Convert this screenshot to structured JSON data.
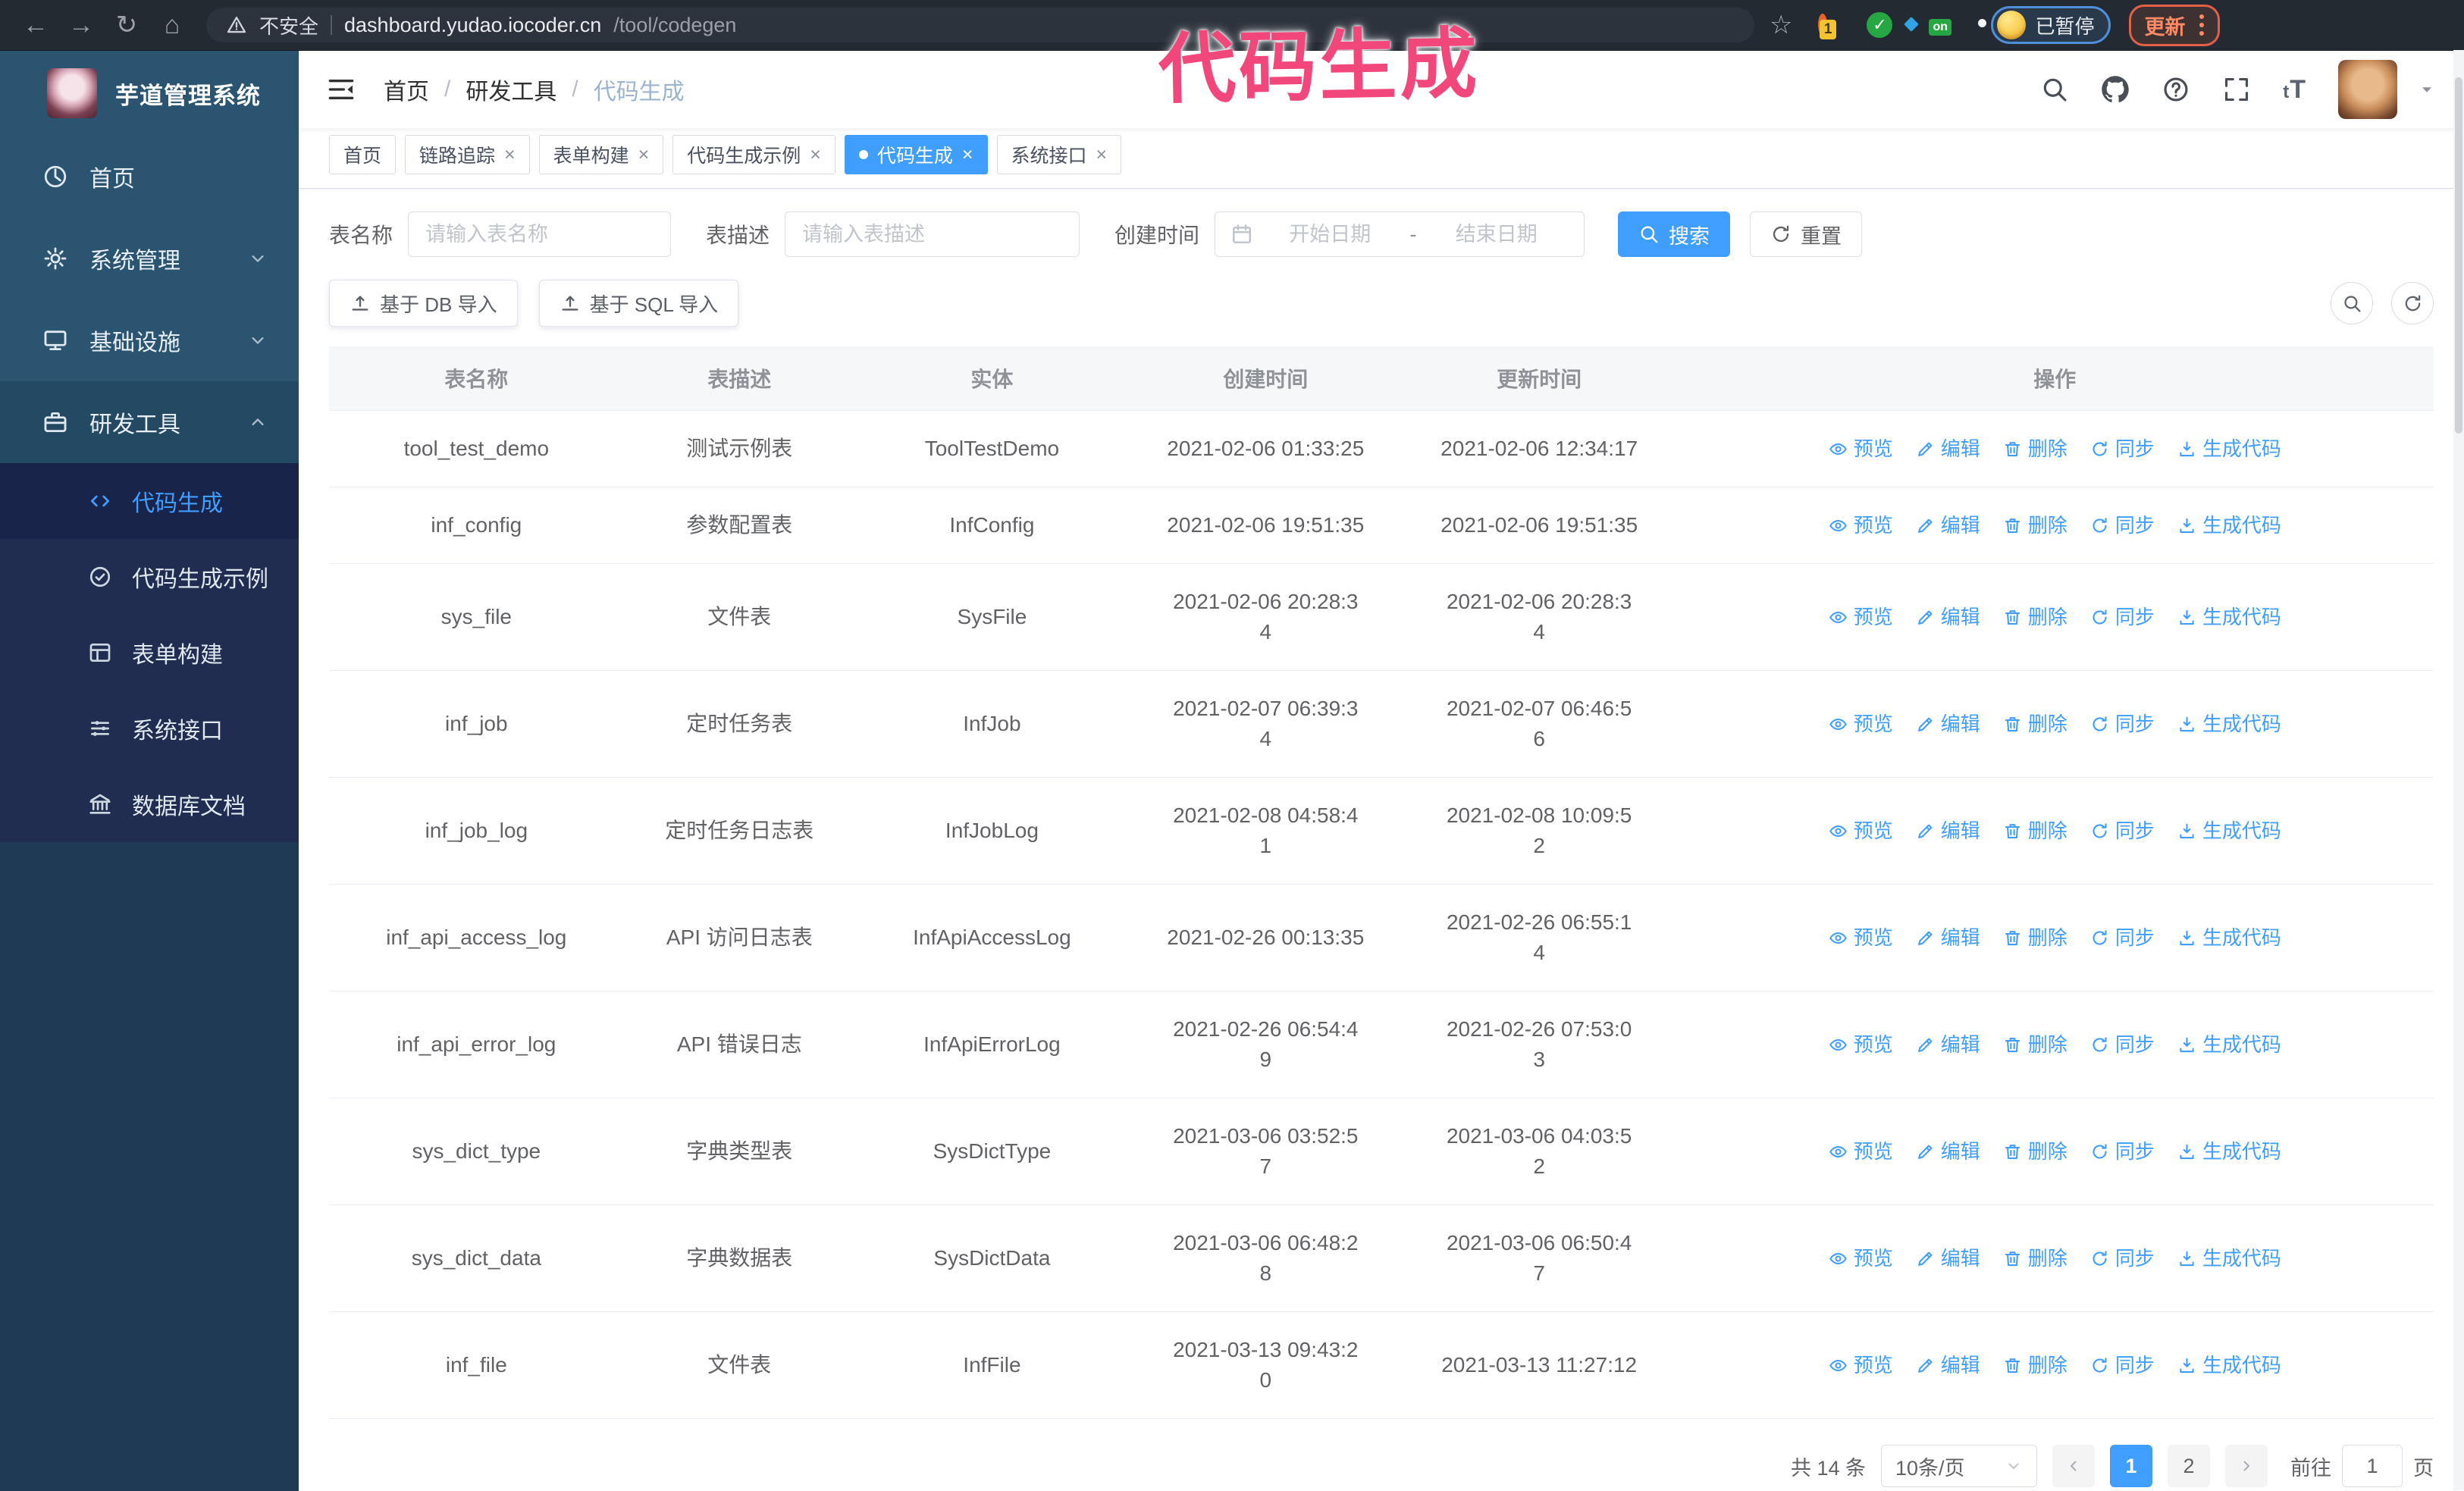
{
  "colors": {
    "accent": "#409eff",
    "annotation_pink": "#f2477b",
    "sidebar_bg": "#2a5470",
    "submenu_bg": "#202c50"
  },
  "browser": {
    "security_label": "不安全",
    "url_host": "dashboard.yudao.iocoder.cn",
    "url_path": "/tool/codegen",
    "extension_badge": "1",
    "extension_on_badge": "on",
    "paused_badge": "已暂停",
    "update_button": "更新"
  },
  "annotation": {
    "text": "代码生成"
  },
  "sidebar": {
    "title": "芋道管理系统",
    "menu": [
      {
        "label": "首页",
        "icon": "dashboard-icon",
        "chevron": ""
      },
      {
        "label": "系统管理",
        "icon": "gear-icon",
        "chevron": "down"
      },
      {
        "label": "基础设施",
        "icon": "infra-icon",
        "chevron": "down"
      },
      {
        "label": "研发工具",
        "icon": "tools-icon",
        "chevron": "up",
        "open": true
      }
    ],
    "submenu": [
      {
        "label": "代码生成",
        "icon": "code-icon",
        "active": true
      },
      {
        "label": "代码生成示例",
        "icon": "example-icon",
        "active": false
      },
      {
        "label": "表单构建",
        "icon": "form-icon",
        "active": false
      },
      {
        "label": "系统接口",
        "icon": "api-icon",
        "active": false
      },
      {
        "label": "数据库文档",
        "icon": "db-icon",
        "active": false
      }
    ]
  },
  "header": {
    "breadcrumb": [
      "首页",
      "研发工具",
      "代码生成"
    ]
  },
  "tabs": [
    {
      "label": "首页",
      "closable": false,
      "active": false
    },
    {
      "label": "链路追踪",
      "closable": true,
      "active": false
    },
    {
      "label": "表单构建",
      "closable": true,
      "active": false
    },
    {
      "label": "代码生成示例",
      "closable": true,
      "active": false
    },
    {
      "label": "代码生成",
      "closable": true,
      "active": true
    },
    {
      "label": "系统接口",
      "closable": true,
      "active": false
    }
  ],
  "search": {
    "name_label": "表名称",
    "name_placeholder": "请输入表名称",
    "desc_label": "表描述",
    "desc_placeholder": "请输入表描述",
    "time_label": "创建时间",
    "start_placeholder": "开始日期",
    "range_separator": "-",
    "end_placeholder": "结束日期",
    "search_button": "搜索",
    "reset_button": "重置"
  },
  "toolbar": {
    "import_db": "基于 DB 导入",
    "import_sql": "基于 SQL 导入"
  },
  "table": {
    "columns": [
      "表名称",
      "表描述",
      "实体",
      "创建时间",
      "更新时间",
      "操作"
    ],
    "actions": [
      {
        "label": "预览",
        "icon": "eye-icon"
      },
      {
        "label": "编辑",
        "icon": "edit-icon"
      },
      {
        "label": "删除",
        "icon": "delete-icon"
      },
      {
        "label": "同步",
        "icon": "sync-icon"
      },
      {
        "label": "生成代码",
        "icon": "download-icon"
      }
    ],
    "rows": [
      {
        "name": "tool_test_demo",
        "desc": "测试示例表",
        "entity": "ToolTestDemo",
        "create": [
          "2021-02-06 01:33:25"
        ],
        "update": [
          "2021-02-06 12:34:17"
        ]
      },
      {
        "name": "inf_config",
        "desc": "参数配置表",
        "entity": "InfConfig",
        "create": [
          "2021-02-06 19:51:35"
        ],
        "update": [
          "2021-02-06 19:51:35"
        ]
      },
      {
        "name": "sys_file",
        "desc": "文件表",
        "entity": "SysFile",
        "create": [
          "2021-02-06 20:28:3",
          "4"
        ],
        "update": [
          "2021-02-06 20:28:3",
          "4"
        ]
      },
      {
        "name": "inf_job",
        "desc": "定时任务表",
        "entity": "InfJob",
        "create": [
          "2021-02-07 06:39:3",
          "4"
        ],
        "update": [
          "2021-02-07 06:46:5",
          "6"
        ]
      },
      {
        "name": "inf_job_log",
        "desc": "定时任务日志表",
        "entity": "InfJobLog",
        "create": [
          "2021-02-08 04:58:4",
          "1"
        ],
        "update": [
          "2021-02-08 10:09:5",
          "2"
        ]
      },
      {
        "name": "inf_api_access_log",
        "desc": "API 访问日志表",
        "entity": "InfApiAccessLog",
        "create": [
          "2021-02-26 00:13:35"
        ],
        "update": [
          "2021-02-26 06:55:1",
          "4"
        ]
      },
      {
        "name": "inf_api_error_log",
        "desc": "API 错误日志",
        "entity": "InfApiErrorLog",
        "create": [
          "2021-02-26 06:54:4",
          "9"
        ],
        "update": [
          "2021-02-26 07:53:0",
          "3"
        ]
      },
      {
        "name": "sys_dict_type",
        "desc": "字典类型表",
        "entity": "SysDictType",
        "create": [
          "2021-03-06 03:52:5",
          "7"
        ],
        "update": [
          "2021-03-06 04:03:5",
          "2"
        ]
      },
      {
        "name": "sys_dict_data",
        "desc": "字典数据表",
        "entity": "SysDictData",
        "create": [
          "2021-03-06 06:48:2",
          "8"
        ],
        "update": [
          "2021-03-06 06:50:4",
          "7"
        ]
      },
      {
        "name": "inf_file",
        "desc": "文件表",
        "entity": "InfFile",
        "create": [
          "2021-03-13 09:43:2",
          "0"
        ],
        "update": [
          "2021-03-13 11:27:12"
        ]
      }
    ]
  },
  "pagination": {
    "total_label": "共 14 条",
    "page_size": "10条/页",
    "pages": [
      "1",
      "2"
    ],
    "current_page": "1",
    "goto_label": "前往",
    "goto_value": "1",
    "page_suffix": "页"
  }
}
